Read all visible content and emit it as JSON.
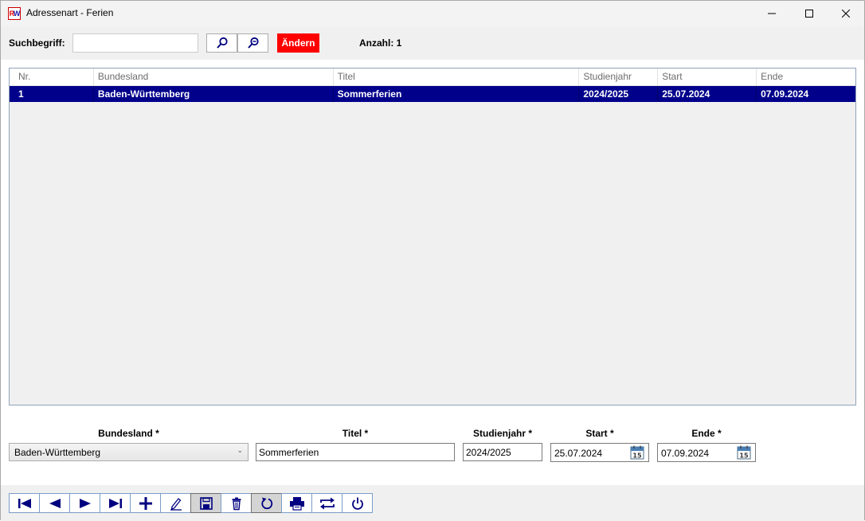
{
  "window": {
    "title": "Adressenart - Ferien",
    "app_icon": "RW"
  },
  "toolbar": {
    "search_label": "Suchbegriff:",
    "search_value": "",
    "search_icon": "search-icon",
    "search_clear_icon": "zoom-out-icon",
    "change_label": "Ändern",
    "count_label": "Anzahl: 1"
  },
  "grid": {
    "columns": [
      "Nr.",
      "Bundesland",
      "Titel",
      "Studienjahr",
      "Start",
      "Ende"
    ],
    "rows": [
      {
        "nr": "1",
        "bundesland": "Baden-Württemberg",
        "titel": "Sommerferien",
        "studienjahr": "2024/2025",
        "start": "25.07.2024",
        "ende": "07.09.2024",
        "selected": true
      }
    ],
    "selected_row_color": "#00008b"
  },
  "form": {
    "bundesland_label": "Bundesland *",
    "bundesland_value": "Baden-Württemberg",
    "titel_label": "Titel *",
    "titel_value": "Sommerferien",
    "studienjahr_label": "Studienjahr *",
    "studienjahr_value": "2024/2025",
    "start_label": "Start *",
    "start_value": "25.07.2024",
    "ende_label": "Ende *",
    "ende_value": "07.09.2024",
    "calendar_day": "15"
  },
  "navigation": {
    "buttons": [
      "first-record-icon",
      "previous-record-icon",
      "next-record-icon",
      "last-record-icon",
      "add-icon",
      "edit-icon",
      "save-icon",
      "delete-icon",
      "refresh-icon",
      "print-icon",
      "swap-icon",
      "power-icon"
    ],
    "pressed": [
      "save-icon",
      "refresh-icon"
    ]
  },
  "colors": {
    "accent": "#00008b",
    "change_button": "#ff0000",
    "icon": "#000080"
  }
}
